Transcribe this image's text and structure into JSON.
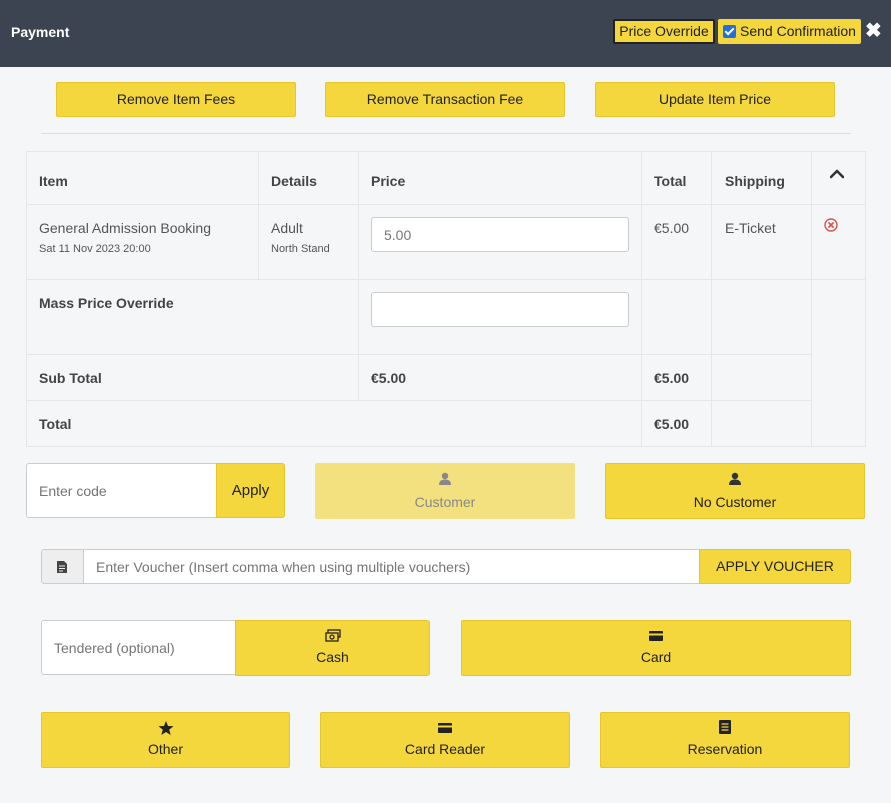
{
  "header": {
    "title": "Payment",
    "price_override_label": "Price Override",
    "send_confirmation_label": "Send Confirmation",
    "send_confirmation_checked": true,
    "close_glyph": "✖"
  },
  "actions": {
    "remove_item_fees": "Remove Item Fees",
    "remove_transaction_fee": "Remove Transaction Fee",
    "update_item_price": "Update Item Price"
  },
  "table": {
    "headers": [
      "Item",
      "Details",
      "Price",
      "Total",
      "Shipping"
    ],
    "row": {
      "item": "General Admission Booking",
      "date": "Sat 11 Nov 2023 20:00",
      "details": "Adult",
      "details_sub": "North Stand",
      "price_value": "5.00",
      "total": "€5.00",
      "shipping": "E-Ticket"
    },
    "mass_override_label": "Mass Price Override",
    "mass_override_value": "",
    "subtotal_label": "Sub Total",
    "subtotal_price": "€5.00",
    "subtotal_total": "€5.00",
    "total_label": "Total",
    "total_total": "€5.00"
  },
  "code": {
    "placeholder": "Enter code",
    "apply_label": "Apply"
  },
  "customer": {
    "customer_label": "Customer",
    "no_customer_label": "No Customer"
  },
  "voucher": {
    "placeholder": "Enter Voucher (Insert comma when using multiple vouchers)",
    "apply_label": "APPLY VOUCHER"
  },
  "payment": {
    "tendered_placeholder": "Tendered (optional)",
    "cash_label": "Cash",
    "card_label": "Card",
    "other_label": "Other",
    "card_reader_label": "Card Reader",
    "reservation_label": "Reservation"
  },
  "colors": {
    "header_bg": "#3d4451",
    "accent_yellow": "#f4d63d",
    "muted_yellow": "#f3e07f"
  },
  "icons": [
    "close-icon",
    "chevron-up-icon",
    "remove-icon",
    "user-icon",
    "document-icon",
    "cash-icon",
    "card-icon",
    "star-icon",
    "clipboard-icon"
  ]
}
